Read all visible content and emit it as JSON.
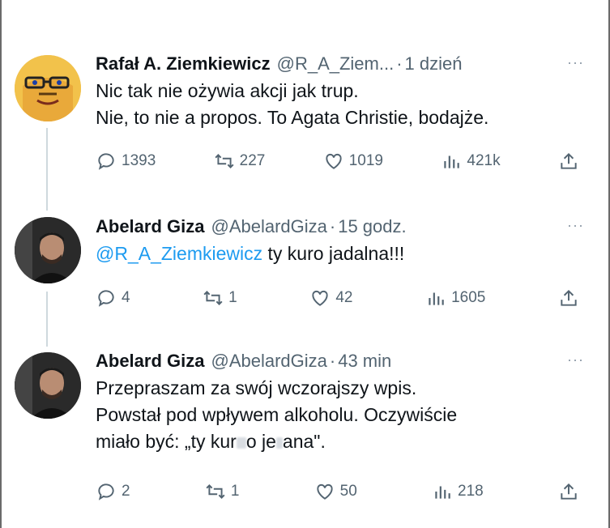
{
  "tweets": [
    {
      "name": "Rafał A. Ziemkiewicz",
      "handle": "@R_A_Ziem...",
      "time": "1 dzień",
      "more": "···",
      "lines": [
        "Nic tak nie ożywia akcji jak trup.",
        "Nie, to nie a propos. To Agata Christie, bodajże."
      ],
      "replies": "1393",
      "retweets": "227",
      "likes": "1019",
      "views": "421k"
    },
    {
      "name": "Abelard Giza",
      "handle": "@AbelardGiza",
      "time": "15 godz.",
      "more": "···",
      "mention": "@R_A_Ziemkiewicz",
      "text": " ty kuro jadalna!!!",
      "replies": "4",
      "retweets": "1",
      "likes": "42",
      "views": "1605"
    },
    {
      "name": "Abelard Giza",
      "handle": "@AbelardGiza",
      "time": "43 min",
      "more": "···",
      "lines": [
        "Przepraszam za swój wczorajszy wpis.",
        "Powstał pod wpływem alkoholu. Oczywiście"
      ],
      "line3_a": "miało być: „ty kur",
      "line3_b": "o je",
      "line3_c": "ana\".",
      "replies": "2",
      "retweets": "1",
      "likes": "50",
      "views": "218"
    }
  ],
  "icons": [
    "reply-icon",
    "retweet-icon",
    "like-icon",
    "views-icon",
    "share-icon"
  ],
  "colors": {
    "mention": "#1d9bf0",
    "secondary": "#536471",
    "text": "#0f1419"
  }
}
